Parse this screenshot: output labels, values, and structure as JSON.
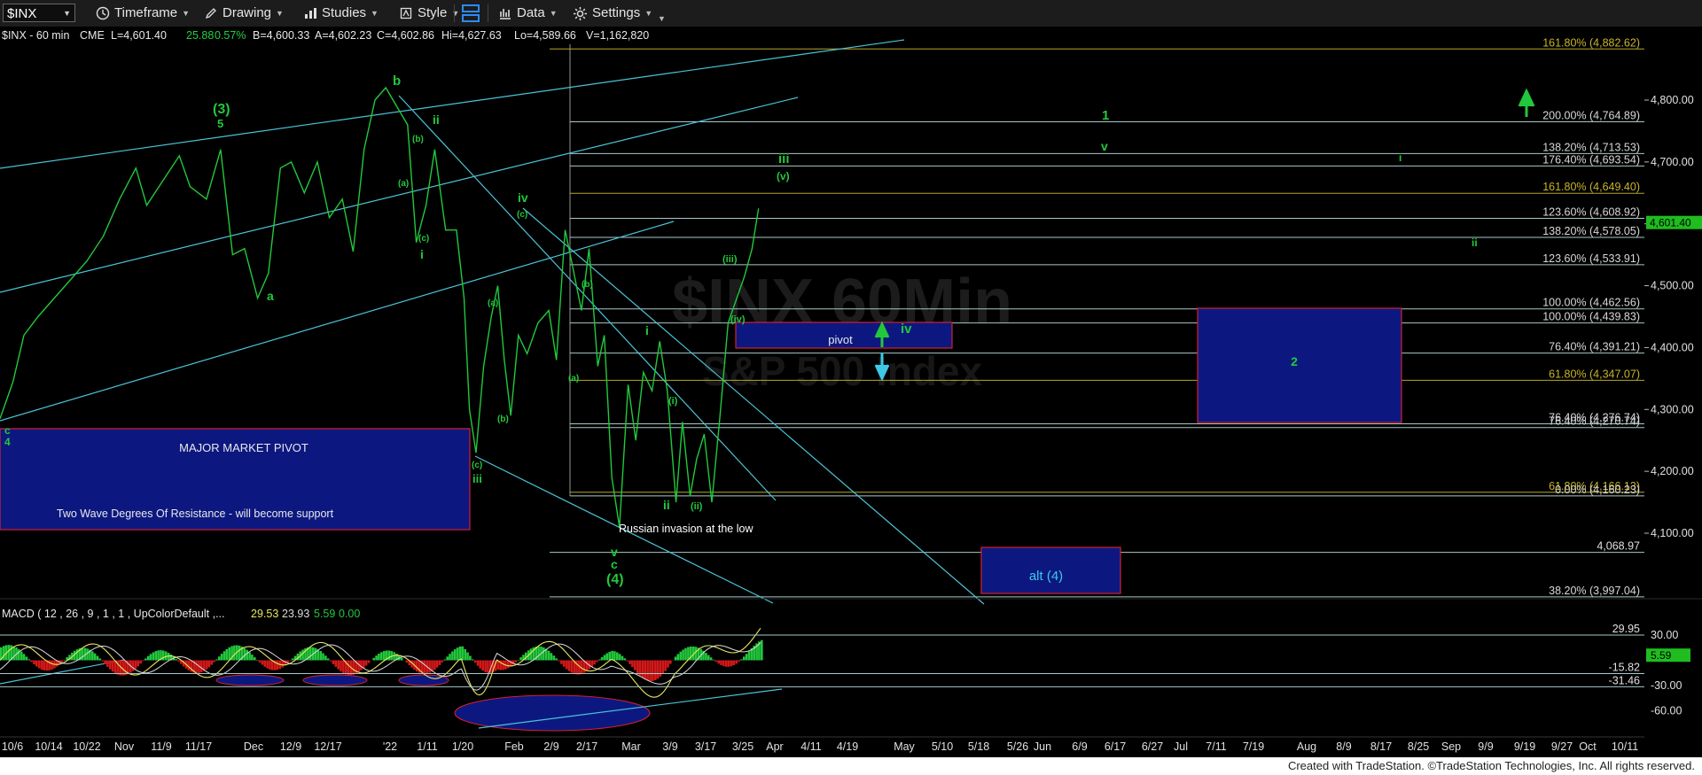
{
  "toolbar": {
    "symbol": "$INX",
    "timeframe": "Timeframe",
    "drawing": "Drawing",
    "studies": "Studies",
    "style": "Style",
    "data": "Data",
    "settings": "Settings"
  },
  "header": {
    "symbol_info": "$INX - 60 min",
    "exchange": "CME",
    "last": "L=4,601.40",
    "change": "25.88",
    "change_pct": "0.57%",
    "bid": "B=4,600.33",
    "ask": "A=4,602.23",
    "close": "C=4,602.86",
    "high": "Hi=4,627.63",
    "low": "Lo=4,589.66",
    "volume": "V=1,162,820"
  },
  "watermark": {
    "symbol": "$INX 60Min",
    "name": "S&P 500 Index"
  },
  "colors": {
    "price": "#22c83c",
    "fib_line": "#a8dcdc",
    "fib_label": "#35b8b8",
    "fib_gold": "#c8b428",
    "wave_label": "#22c83c",
    "box_fill": "#0c1880",
    "box_border": "#d42030",
    "macd_line": "#e8e860",
    "signal_line": "#dcdcdc",
    "hist_pos": "#22c83c",
    "hist_neg": "#d41818",
    "current_price_bg": "#1fbd1f"
  },
  "chart_data": {
    "type": "line",
    "title": "$INX - 60 min",
    "ylim": [
      3940,
      4890
    ],
    "y_ticks": [
      4100,
      4200,
      4300,
      4400,
      4500,
      4600,
      4700,
      4800
    ],
    "y_tick_labels": [
      "4,100.00",
      "4,200.00",
      "4,300.00",
      "4,400.00",
      "4,500.00",
      "4,600.00",
      "4,700.00",
      "4,800.00"
    ],
    "current_price": 4601.4,
    "current_price_label": "4,601.40",
    "x_ticks": [
      "10/6",
      "10/14",
      "10/22",
      "Nov",
      "11/9",
      "11/17",
      "Dec",
      "12/9",
      "12/17",
      "'22",
      "1/11",
      "1/20",
      "Feb",
      "2/9",
      "2/17",
      "Mar",
      "3/9",
      "3/17",
      "3/25",
      "Apr",
      "4/11",
      "4/19",
      "May",
      "5/10",
      "5/18",
      "5/26",
      "Jun",
      "6/9",
      "6/17",
      "6/27",
      "Jul",
      "7/11",
      "7/19",
      "Aug",
      "8/9",
      "8/17",
      "8/25",
      "Sep",
      "9/9",
      "9/19",
      "9/27",
      "Oct",
      "10/11"
    ],
    "price_series": {
      "name": "$INX",
      "x": [
        0,
        12,
        22,
        35,
        50,
        65,
        80,
        95,
        110,
        125,
        135,
        150,
        165,
        175,
        190,
        203,
        214,
        225,
        237,
        247,
        258,
        268,
        280,
        292,
        303,
        315,
        325,
        335,
        345,
        355,
        365,
        375,
        383,
        392,
        400,
        410,
        420,
        427,
        432,
        438,
        445,
        452,
        458,
        464,
        470,
        477,
        485,
        495,
        505,
        512,
        520,
        527,
        535,
        542,
        550,
        556,
        563,
        570,
        578,
        585,
        592,
        600,
        607,
        614,
        622,
        628,
        635,
        641,
        648,
        655,
        662,
        670,
        678,
        685,
        692,
        698
      ],
      "y": [
        4285,
        4345,
        4420,
        4450,
        4480,
        4510,
        4540,
        4580,
        4640,
        4690,
        4630,
        4670,
        4710,
        4660,
        4640,
        4720,
        4550,
        4560,
        4480,
        4520,
        4690,
        4700,
        4650,
        4700,
        4610,
        4640,
        4555,
        4720,
        4800,
        4820,
        4790,
        4760,
        4570,
        4630,
        4720,
        4590,
        4590,
        4480,
        4300,
        4230,
        4370,
        4450,
        4500,
        4380,
        4290,
        4420,
        4390,
        4440,
        4460,
        4380,
        4590,
        4530,
        4460,
        4560,
        4370,
        4420,
        4190,
        4110,
        4340,
        4250,
        4360,
        4330,
        4410,
        4330,
        4150,
        4280,
        4160,
        4220,
        4260,
        4150,
        4280,
        4440,
        4480,
        4515,
        4560,
        4625
      ]
    },
    "fib_levels": [
      {
        "label": "161.80% (4,882.62)",
        "value": 4882.62
      },
      {
        "label": "200.00% (4,764.89)",
        "value": 4764.89
      },
      {
        "label": "138.20% (4,713.53)",
        "value": 4713.53
      },
      {
        "label": "176.40% (4,693.54)",
        "value": 4693.54
      },
      {
        "label": "161.80% (4,649.40)",
        "value": 4649.4
      },
      {
        "label": "123.60% (4,608.92)",
        "value": 4608.92
      },
      {
        "label": "138.20% (4,578.05)",
        "value": 4578.05
      },
      {
        "label": "123.60% (4,533.91)",
        "value": 4533.91
      },
      {
        "label": "100.00% (4,462.56)",
        "value": 4462.56
      },
      {
        "label": "100.00% (4,439.83)",
        "value": 4439.83
      },
      {
        "label": "76.40% (4,391.21)",
        "value": 4391.21
      },
      {
        "label": "61.80% (4,347.07)",
        "value": 4347.07
      },
      {
        "label": "76.40% (4,276.74)",
        "value": 4276.74
      },
      {
        "label": "76.40% (4,270.74)",
        "value": 4270.74
      },
      {
        "label": "61.80% (4,166.13)",
        "value": 4166.13
      },
      {
        "label": "0.00% (4,160.23)",
        "value": 4160.23
      },
      {
        "label": "4,068.97",
        "value": 4068.97
      },
      {
        "label": "38.20% (3,997.04)",
        "value": 3997.04
      }
    ],
    "annotations": [
      "MAJOR MARKET PIVOT",
      "Two Wave Degrees Of Resistance - will become support",
      "pivot",
      "2",
      "alt (4)",
      "Russian invasion at the low"
    ],
    "wave_labels": [
      "(3)",
      "5",
      "b",
      "ii",
      "a",
      "c",
      "4",
      "iv",
      "i",
      "(c)",
      "iii",
      "(a)",
      "(b)",
      "(c)",
      "v",
      "c",
      "(4)",
      "i",
      "ii",
      "(i)",
      "(ii)",
      "(iii)",
      "(iv)",
      "(v)",
      "iii",
      "iv",
      "1",
      "v",
      "i",
      "ii",
      "(a)",
      "(b)",
      "(c)",
      "(a)",
      "(b)"
    ],
    "macd": {
      "title": "MACD ( 12 , 26 , 9 , 1 , 1 , UpColorDefault ,...",
      "macd": "29.53",
      "signal": "23.93",
      "diff": "5.59",
      "zero": "0.00",
      "ylim": [
        -80,
        50
      ],
      "levels": [
        {
          "label": "29.95",
          "value": 29.95
        },
        {
          "label": "-15.82",
          "value": -15.82
        },
        {
          "label": "-31.46",
          "value": -31.46
        }
      ],
      "y_ticks": [
        "30.00",
        "-30.00",
        "-60.00"
      ],
      "current_label": "5.59"
    }
  },
  "footer": {
    "credit": "Created with TradeStation. ©TradeStation Technologies, Inc. All rights reserved."
  }
}
